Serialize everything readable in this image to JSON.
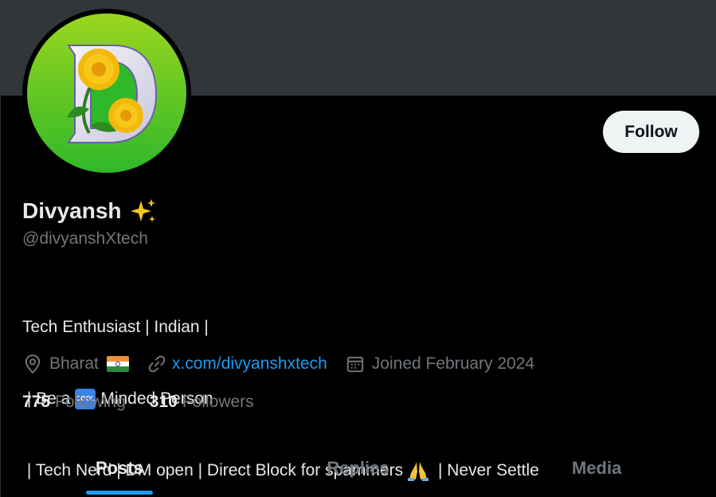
{
  "profile": {
    "name": "Divyansh",
    "handle": "@divyanshXtech",
    "follow_label": "Follow",
    "bio": {
      "line1": "Tech Enthusiast | Indian |",
      "line2_before": " | Be a",
      "line2_badge": "COOL",
      "line2_after": "Minded Person",
      "line3_before": " | Tech Nerd | DM open | Direct Block for spammers",
      "line3_after": " | Never Settle"
    },
    "location": "Bharat",
    "website": "x.com/divyanshxtech",
    "joined": "Joined February 2024",
    "following_count": "775",
    "following_label": "Following",
    "followers_count": "310",
    "followers_label": "Followers"
  },
  "tabs": [
    {
      "label": "Posts",
      "active": true
    },
    {
      "label": "Replies",
      "active": false
    },
    {
      "label": "Media",
      "active": false
    }
  ],
  "icons": {
    "location": "location-pin-icon",
    "link": "link-icon",
    "calendar": "calendar-icon",
    "sparkle": "sparkles-emoji",
    "pray": "folded-hands-emoji",
    "flag": "india-flag-emoji"
  },
  "colors": {
    "background": "#000000",
    "banner": "#333639",
    "accent": "#1d9bf0",
    "text_primary": "#e7e9ea",
    "text_secondary": "#71767b",
    "button_bg": "#eff3f4"
  }
}
